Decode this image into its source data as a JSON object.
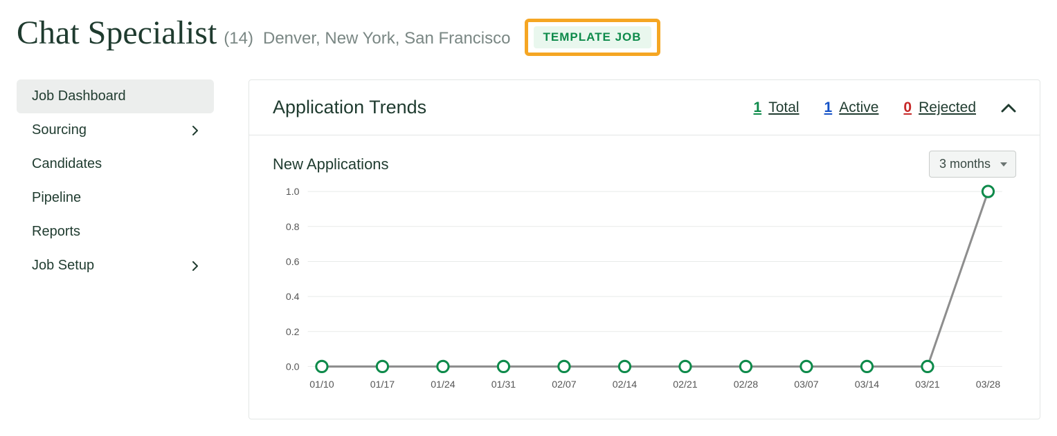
{
  "header": {
    "title": "Chat Specialist",
    "count": "(14)",
    "locations": "Denver, New York, San Francisco",
    "template_badge": "TEMPLATE JOB"
  },
  "sidebar": {
    "items": [
      {
        "label": "Job Dashboard",
        "has_chevron": false,
        "active": true
      },
      {
        "label": "Sourcing",
        "has_chevron": true,
        "active": false
      },
      {
        "label": "Candidates",
        "has_chevron": false,
        "active": false
      },
      {
        "label": "Pipeline",
        "has_chevron": false,
        "active": false
      },
      {
        "label": "Reports",
        "has_chevron": false,
        "active": false
      },
      {
        "label": "Job Setup",
        "has_chevron": true,
        "active": false
      }
    ]
  },
  "panel": {
    "title": "Application Trends",
    "metrics": [
      {
        "num": "1",
        "label": "Total",
        "color": "green"
      },
      {
        "num": "1",
        "label": "Active",
        "color": "blue"
      },
      {
        "num": "0",
        "label": "Rejected",
        "color": "red"
      }
    ],
    "chart_title": "New Applications",
    "range_selected": "3 months"
  },
  "chart_data": {
    "type": "line",
    "title": "New Applications",
    "xlabel": "",
    "ylabel": "",
    "ylim": [
      0,
      1.0
    ],
    "y_ticks": [
      "0.0",
      "0.2",
      "0.4",
      "0.6",
      "0.8",
      "1.0"
    ],
    "categories": [
      "01/10",
      "01/17",
      "01/24",
      "01/31",
      "02/07",
      "02/14",
      "02/21",
      "02/28",
      "03/07",
      "03/14",
      "03/21",
      "03/28"
    ],
    "values": [
      0,
      0,
      0,
      0,
      0,
      0,
      0,
      0,
      0,
      0,
      0,
      1
    ]
  }
}
